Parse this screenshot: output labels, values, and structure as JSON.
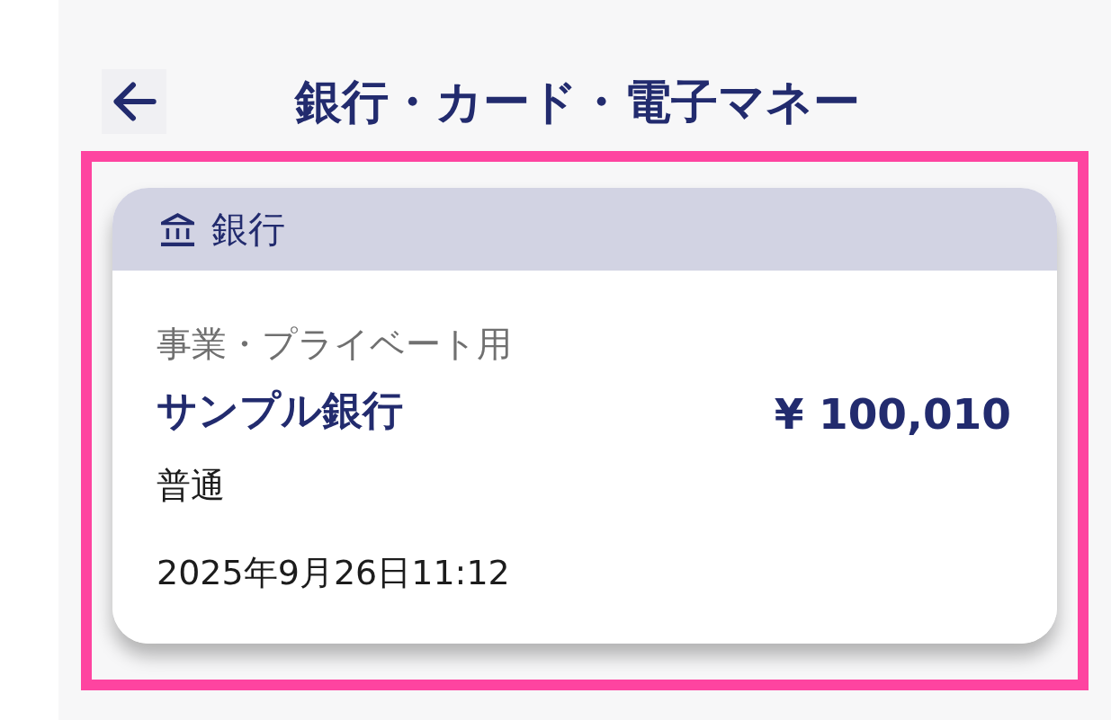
{
  "header": {
    "title": "銀行・カード・電子マネー"
  },
  "sections": [
    {
      "kind": "bank",
      "heading": "銀行",
      "highlighted": true,
      "accounts": [
        {
          "category": "事業・プライベート用",
          "name": "サンプル銀行",
          "balance": "¥ 100,010",
          "account_type": "普通",
          "updated": "2025年9月26日11:12"
        }
      ]
    }
  ]
}
